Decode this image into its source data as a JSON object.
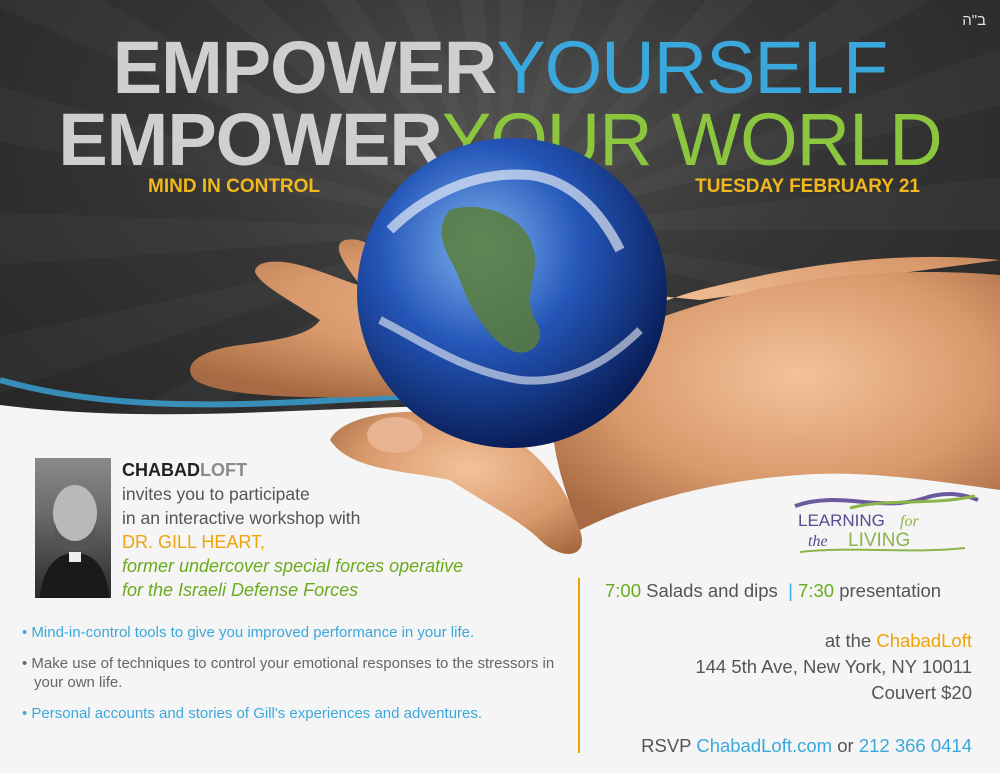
{
  "hebrew_mark": "ב\"ה",
  "headline": {
    "line1_bold": "EMPOWER",
    "line1_light": "YOURSELF",
    "line2_bold": "EMPOWER",
    "line2_light": "YOUR WORLD"
  },
  "subheads": {
    "left": "MIND IN CONTROL",
    "right": "TUESDAY FEBRUARY 21"
  },
  "intro": {
    "brand_bold": "CHABAD",
    "brand_light": "LOFT",
    "line1": "invites you to participate",
    "line2": "in an interactive workshop with",
    "doctor": "DR. GILL HEART,",
    "role1": "former undercover special forces operative",
    "role2": "for the Israeli Defense Forces"
  },
  "bullets": [
    "Mind-in-control tools to give you improved performance in your life.",
    "Make use of techniques to control your emotional responses to the stressors in your own life.",
    "Personal accounts and stories of Gill's experiences and adventures."
  ],
  "logo": {
    "line1": "LEARNING",
    "for": "for",
    "the": "the",
    "line2": "LIVING"
  },
  "schedule": {
    "time1": "7:00",
    "event1": "Salads and dips",
    "sep": "|",
    "time2": "7:30",
    "event2": "presentation"
  },
  "venue": {
    "at_prefix": "at the",
    "at_name": "ChabadLoft",
    "address": "144 5th Ave, New York, NY 10011",
    "couvert": "Couvert $20"
  },
  "rsvp": {
    "label": "RSVP",
    "site": "ChabadLoft.com",
    "or": "or",
    "phone": "212 366 0414"
  },
  "colors": {
    "blue": "#3aa8dc",
    "green": "#8cc63f",
    "orange": "#f0a30a",
    "yellow": "#f2b81b"
  }
}
